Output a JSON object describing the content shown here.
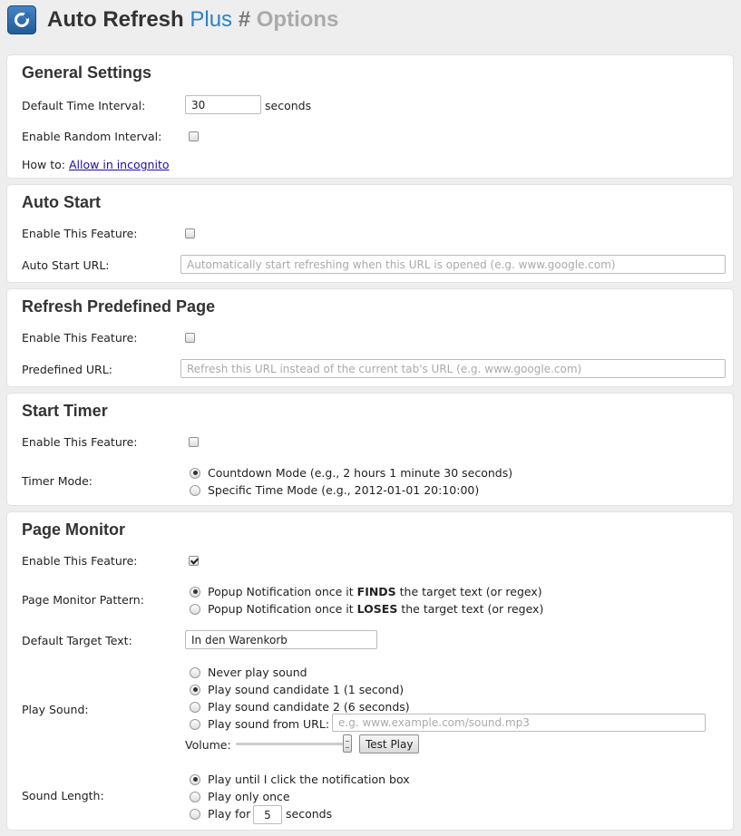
{
  "header": {
    "title_main": "Auto Refresh",
    "title_plus": "Plus",
    "title_hash": "#",
    "title_options": "Options",
    "logo_icon": "refresh-logo-icon"
  },
  "general": {
    "heading": "General Settings",
    "interval_label": "Default Time Interval:",
    "interval_value": "30",
    "interval_unit": "seconds",
    "random_label": "Enable Random Interval:",
    "random_checked": false,
    "howto_label": "How to:",
    "howto_link": "Allow in incognito"
  },
  "auto_start": {
    "heading": "Auto Start",
    "enable_label": "Enable This Feature:",
    "enable_checked": false,
    "url_label": "Auto Start URL:",
    "url_placeholder": "Automatically start refreshing when this URL is opened (e.g. www.google.com)"
  },
  "predefined": {
    "heading": "Refresh Predefined Page",
    "enable_label": "Enable This Feature:",
    "enable_checked": false,
    "url_label": "Predefined URL:",
    "url_placeholder": "Refresh this URL instead of the current tab's URL (e.g. www.google.com)"
  },
  "start_timer": {
    "heading": "Start Timer",
    "enable_label": "Enable This Feature:",
    "enable_checked": false,
    "mode_label": "Timer Mode:",
    "modes": [
      "Countdown Mode (e.g., 2 hours 1 minute 30 seconds)",
      "Specific Time Mode (e.g., 2012-01-01 20:10:00)"
    ],
    "selected_mode": 0
  },
  "page_monitor": {
    "heading": "Page Monitor",
    "enable_label": "Enable This Feature:",
    "enable_checked": true,
    "pattern_label": "Page Monitor Pattern:",
    "pattern_1_pre": "Popup Notification once it ",
    "pattern_1_bold": "FINDS",
    "pattern_1_post": " the target text (or regex)",
    "pattern_2_pre": "Popup Notification once it ",
    "pattern_2_bold": "LOSES",
    "pattern_2_post": " the target text (or regex)",
    "target_label": "Default Target Text:",
    "target_value": "In den Warenkorb",
    "sound_label": "Play Sound:",
    "sound_options": [
      "Never play sound",
      "Play sound candidate 1 (1 second)",
      "Play sound candidate 2 (6 seconds)",
      "Play sound from URL:"
    ],
    "sound_url_placeholder": "e.g. www.example.com/sound.mp3",
    "volume_label": "Volume:",
    "volume_level": 1.0,
    "test_play_label": "Test Play",
    "length_label": "Sound Length:",
    "length_1": "Play until I click the notification box",
    "length_2": "Play only once",
    "length_3_pre": "Play for",
    "length_3_value": "5",
    "length_3_post": "seconds"
  }
}
